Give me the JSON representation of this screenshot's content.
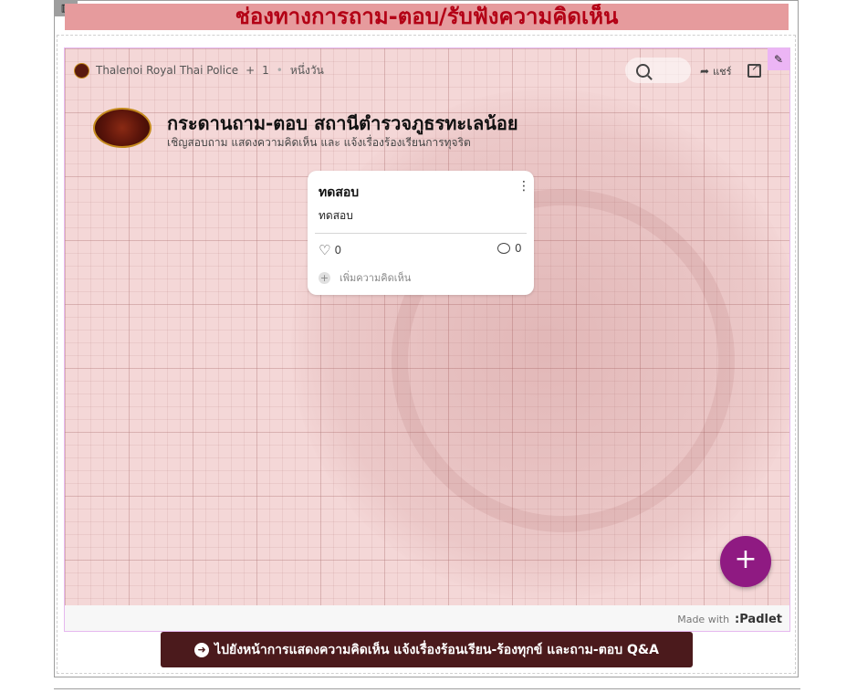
{
  "banner": {
    "title": "ช่องทางการถาม-ตอบ/รับฟังความคิดเห็น"
  },
  "toolbar": {
    "author": "Thalenoi Royal Thai Police",
    "plus": "+",
    "count": "1",
    "time": "หนึ่งวัน",
    "share_label": "แชร์"
  },
  "board": {
    "title": "กระดานถาม-ตอบ สถานีตำรวจภูธรทะเลน้อย",
    "description": "เชิญสอบถาม แสดงความคิดเห็น และ แจ้งเรื่องร้องเรียนการทุจริต"
  },
  "card": {
    "title": "ทดสอบ",
    "body": "ทดสอบ",
    "likes": "0",
    "comments": "0",
    "add_comment": "เพิ่มความคิดเห็น"
  },
  "footer": {
    "made_with": "Made with",
    "brand": "Padlet"
  },
  "cta": {
    "label": "ไปยังหน้าการแสดงความคิดเห็น แจ้งเรื่องร้อนเรียน-ร้องทุกข์ และถาม-ตอบ Q&A"
  },
  "colors": {
    "banner_bg": "#e69b9d",
    "banner_text": "#b30015",
    "fab": "#8f1a82",
    "cta_bg": "#4b1a1c"
  }
}
